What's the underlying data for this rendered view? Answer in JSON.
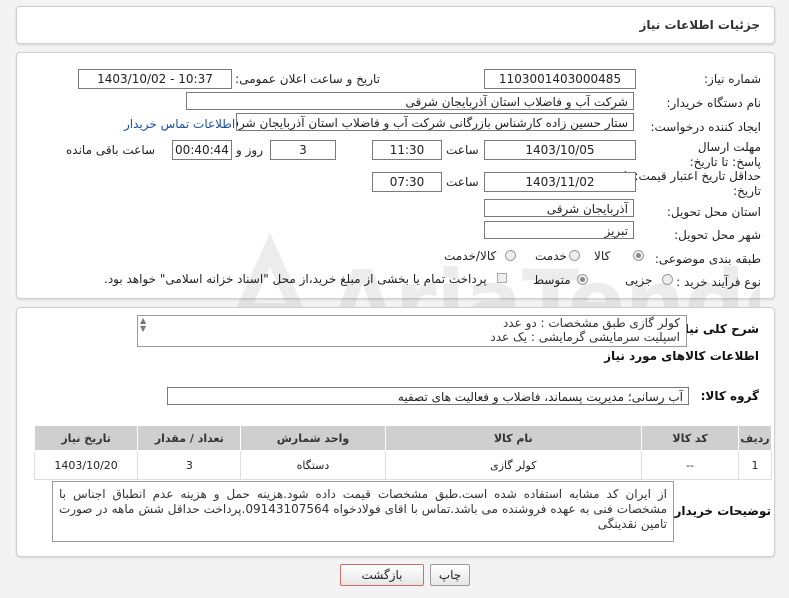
{
  "header": {
    "title": "جزئیات اطلاعات نیاز"
  },
  "fields": {
    "need_number_label": "شماره نیاز:",
    "need_number": "1103001403000485",
    "announce_label": "تاریخ و ساعت اعلان عمومی:",
    "announce_value": "1403/10/02 - 10:37",
    "buyer_org_label": "نام دستگاه خریدار:",
    "buyer_org": "شرکت آب و فاضلاب استان آذربایجان شرقی",
    "requester_label": "ایجاد کننده درخواست:",
    "requester": "ستار حسین زاده کارشناس بازرگانی شرکت آب و فاضلاب استان آذربایجان شرقی",
    "contact_link": "اطلاعات تماس خریدار",
    "deadline_label": "مهلت ارسال پاسخ: تا تاریخ:",
    "deadline_date": "1403/10/05",
    "time_label": "ساعت",
    "deadline_time": "11:30",
    "days_value": "3",
    "days_label": "روز و",
    "remaining_time": "00:40:44",
    "remaining_label": "ساعت باقی مانده",
    "validity_label": "حداقل تاریخ اعتبار قیمت: تا تاریخ:",
    "validity_date": "1403/11/02",
    "validity_time": "07:30",
    "province_label": "استان محل تحویل:",
    "province": "آذربایجان شرقی",
    "city_label": "شهر محل تحویل:",
    "city": "تبریز",
    "category_label": "طبقه بندی موضوعی:",
    "category_options": [
      "کالا",
      "خدمت",
      "کالا/خدمت"
    ],
    "process_label": "نوع فرآیند خرید :",
    "process_options": [
      "جزیی",
      "متوسط"
    ],
    "payment_note": "پرداخت تمام یا بخشی از مبلغ خرید،از محل \"اسناد خزانه اسلامی\" خواهد بود."
  },
  "description": {
    "label": "شرح کلی نیاز:",
    "lines": [
      "کولر گازی طبق مشخصات : دو عدد",
      "اسپلیت سرمایشی گرمایشی : یک عدد"
    ]
  },
  "goods_info": {
    "title": "اطلاعات کالاهای مورد نیاز",
    "group_label": "گروه کالا:",
    "group_value": "آب رسانی؛ مدیریت پسماند، فاضلاب و فعالیت های تصفیه"
  },
  "table": {
    "headers": [
      "ردیف",
      "کد کالا",
      "نام کالا",
      "واحد شمارش",
      "تعداد / مقدار",
      "تاریخ نیاز"
    ],
    "rows": [
      [
        "1",
        "--",
        "کولر گازی",
        "دستگاه",
        "3",
        "1403/10/20"
      ]
    ]
  },
  "buyer_notes": {
    "label": "توضیحات خریدار:",
    "text": "از ایران کد مشابه استفاده شده است.طبق مشخصات قیمت داده شود.هزینه حمل و هزینه عدم انطباق اجناس با مشخصات فنی به عهده فروشنده می باشد.تماس با اقای فولادخواه 09143107564.پرداخت حداقل شش ماهه در صورت تامین نقدینگی"
  },
  "buttons": {
    "print": "چاپ",
    "back": "بازگشت"
  },
  "watermark": {
    "text": "AriaTender.neT"
  },
  "colors": {
    "link": "#1a4fa3",
    "back_button_border": "#d36b6b",
    "table_header": "#cfcfcf"
  }
}
